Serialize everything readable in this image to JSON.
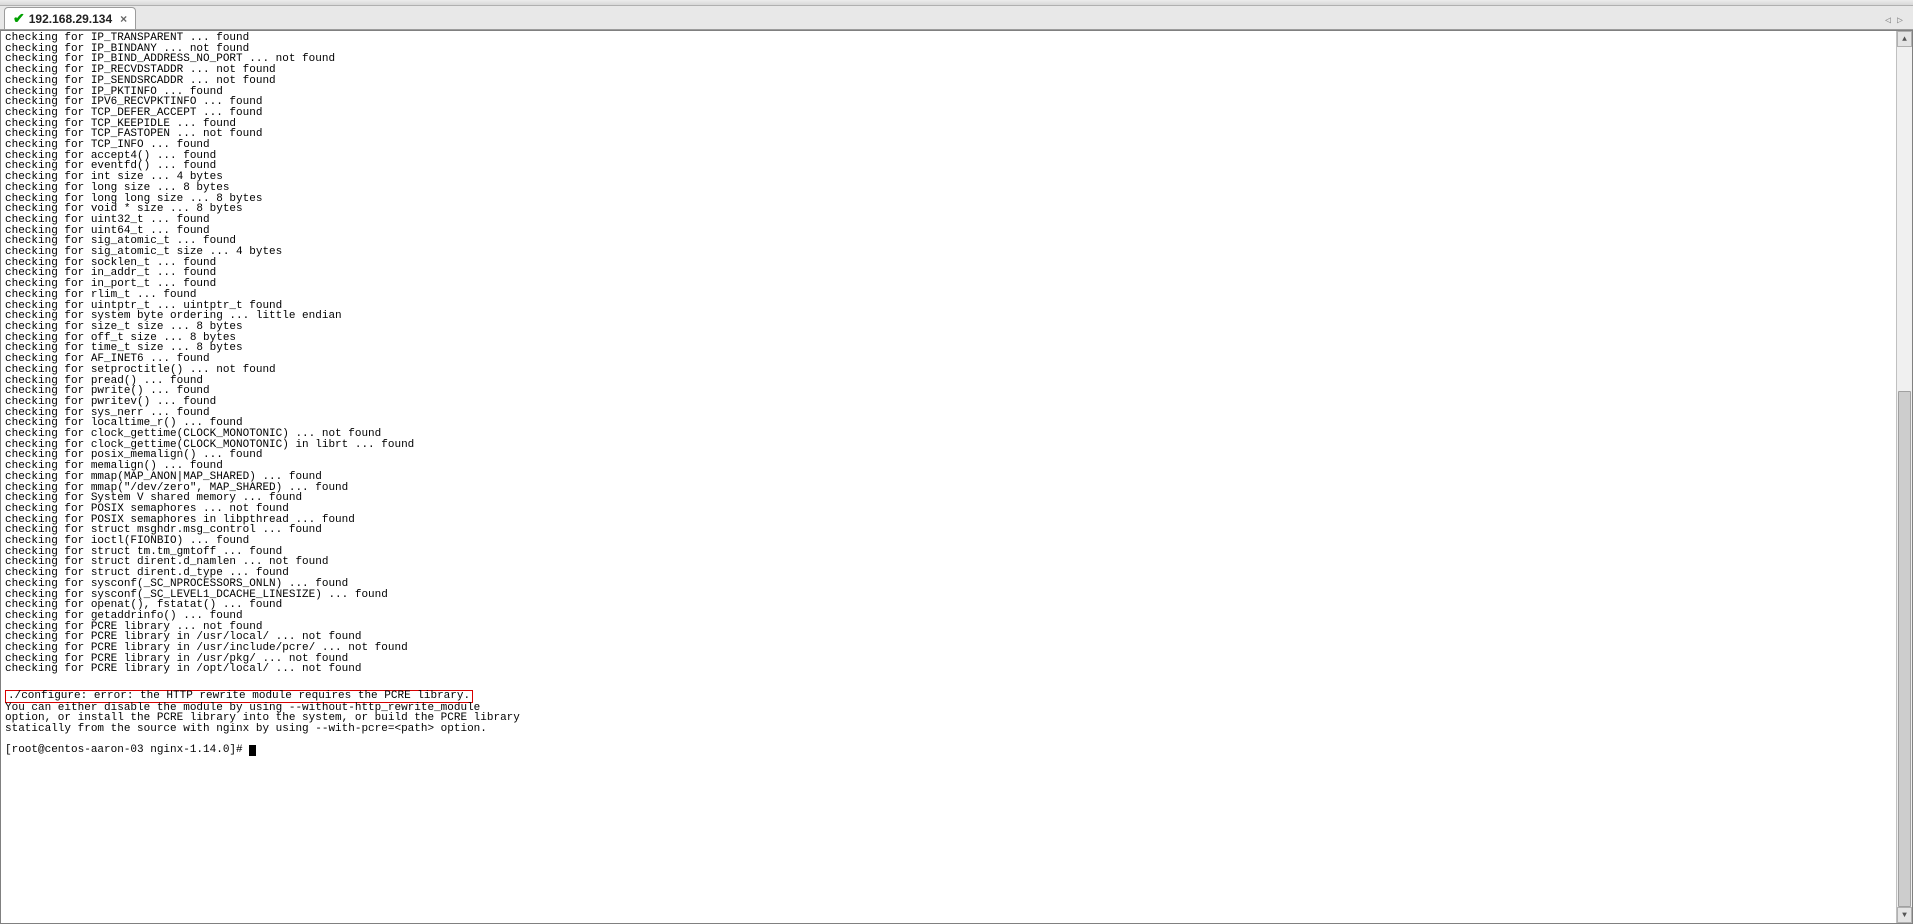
{
  "tab": {
    "title": "192.168.29.134",
    "close_label": "×"
  },
  "terminal": {
    "lines": [
      "checking for IP_TRANSPARENT ... found",
      "checking for IP_BINDANY ... not found",
      "checking for IP_BIND_ADDRESS_NO_PORT ... not found",
      "checking for IP_RECVDSTADDR ... not found",
      "checking for IP_SENDSRCADDR ... not found",
      "checking for IP_PKTINFO ... found",
      "checking for IPV6_RECVPKTINFO ... found",
      "checking for TCP_DEFER_ACCEPT ... found",
      "checking for TCP_KEEPIDLE ... found",
      "checking for TCP_FASTOPEN ... not found",
      "checking for TCP_INFO ... found",
      "checking for accept4() ... found",
      "checking for eventfd() ... found",
      "checking for int size ... 4 bytes",
      "checking for long size ... 8 bytes",
      "checking for long long size ... 8 bytes",
      "checking for void * size ... 8 bytes",
      "checking for uint32_t ... found",
      "checking for uint64_t ... found",
      "checking for sig_atomic_t ... found",
      "checking for sig_atomic_t size ... 4 bytes",
      "checking for socklen_t ... found",
      "checking for in_addr_t ... found",
      "checking for in_port_t ... found",
      "checking for rlim_t ... found",
      "checking for uintptr_t ... uintptr_t found",
      "checking for system byte ordering ... little endian",
      "checking for size_t size ... 8 bytes",
      "checking for off_t size ... 8 bytes",
      "checking for time_t size ... 8 bytes",
      "checking for AF_INET6 ... found",
      "checking for setproctitle() ... not found",
      "checking for pread() ... found",
      "checking for pwrite() ... found",
      "checking for pwritev() ... found",
      "checking for sys_nerr ... found",
      "checking for localtime_r() ... found",
      "checking for clock_gettime(CLOCK_MONOTONIC) ... not found",
      "checking for clock_gettime(CLOCK_MONOTONIC) in librt ... found",
      "checking for posix_memalign() ... found",
      "checking for memalign() ... found",
      "checking for mmap(MAP_ANON|MAP_SHARED) ... found",
      "checking for mmap(\"/dev/zero\", MAP_SHARED) ... found",
      "checking for System V shared memory ... found",
      "checking for POSIX semaphores ... not found",
      "checking for POSIX semaphores in libpthread ... found",
      "checking for struct msghdr.msg_control ... found",
      "checking for ioctl(FIONBIO) ... found",
      "checking for struct tm.tm_gmtoff ... found",
      "checking for struct dirent.d_namlen ... not found",
      "checking for struct dirent.d_type ... found",
      "checking for sysconf(_SC_NPROCESSORS_ONLN) ... found",
      "checking for sysconf(_SC_LEVEL1_DCACHE_LINESIZE) ... found",
      "checking for openat(), fstatat() ... found",
      "checking for getaddrinfo() ... found",
      "checking for PCRE library ... not found",
      "checking for PCRE library in /usr/local/ ... not found",
      "checking for PCRE library in /usr/include/pcre/ ... not found",
      "checking for PCRE library in /usr/pkg/ ... not found",
      "checking for PCRE library in /opt/local/ ... not found"
    ],
    "error_line": "./configure: error: the HTTP rewrite module requires the PCRE library.",
    "trailing_lines": [
      "You can either disable the module by using --without-http_rewrite_module",
      "option, or install the PCRE library into the system, or build the PCRE library",
      "statically from the source with nginx by using --with-pcre=<path> option."
    ],
    "prompt": "[root@centos-aaron-03 nginx-1.14.0]# "
  }
}
